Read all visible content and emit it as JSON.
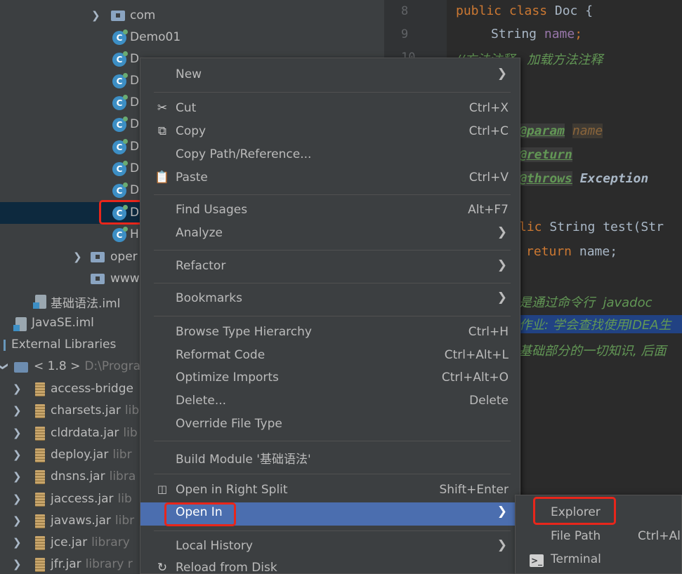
{
  "tree": {
    "com": "com",
    "demo01": "Demo01",
    "partial_items": [
      "D",
      "D",
      "D",
      "D",
      "D",
      "D",
      "D",
      "D"
    ],
    "selected_item": "D",
    "h_item": "H",
    "oper": "oper",
    "www": "www",
    "module_file": "基础语法.iml",
    "javase_file": "JavaSE.iml",
    "external_libraries": "External Libraries",
    "jdk_label": "< 1.8 >",
    "jdk_path": "D:\\Progra",
    "jars": [
      {
        "name": "access-bridge",
        "hint": ""
      },
      {
        "name": "charsets.jar",
        "hint": "lib"
      },
      {
        "name": "cldrdata.jar",
        "hint": "lib"
      },
      {
        "name": "deploy.jar",
        "hint": "libr"
      },
      {
        "name": "dnsns.jar",
        "hint": "libra"
      },
      {
        "name": "jaccess.jar",
        "hint": "lib"
      },
      {
        "name": "javaws.jar",
        "hint": "libr"
      },
      {
        "name": "jce.jar",
        "hint": "library"
      },
      {
        "name": "jfr.jar",
        "hint": "library r"
      }
    ]
  },
  "editor": {
    "line_numbers": [
      "8",
      "9",
      "10"
    ],
    "l8_kw": "public class",
    "l8_rest": " Doc {",
    "l9_type": "String",
    "l9_name": " name",
    "l9_semi": ";",
    "l10_comment": "//方法注释   加载方法注释",
    "tag_param": "@param",
    "param_name": "name",
    "tag_return": "@return",
    "tag_throws": "@throws",
    "exception": "Exception",
    "method_kw": "lic",
    "method_rest": " String test(Str",
    "return_kw": "return",
    "return_rest": " name;",
    "comment_a": "是通过命令行  javadoc",
    "comment_b": "作业: 学会查找使用IDEA生",
    "comment_c": "基础部分的一切知识, 后面"
  },
  "menu": {
    "new": "New",
    "cut": "Cut",
    "cut_sc": "Ctrl+X",
    "copy": "Copy",
    "copy_sc": "Ctrl+C",
    "copy_path": "Copy Path/Reference...",
    "paste": "Paste",
    "paste_sc": "Ctrl+V",
    "find_usages": "Find Usages",
    "find_usages_sc": "Alt+F7",
    "analyze": "Analyze",
    "refactor": "Refactor",
    "bookmarks": "Bookmarks",
    "browse_type_hierarchy": "Browse Type Hierarchy",
    "browse_sc": "Ctrl+H",
    "reformat_code": "Reformat Code",
    "reformat_sc": "Ctrl+Alt+L",
    "optimize_imports": "Optimize Imports",
    "optimize_sc": "Ctrl+Alt+O",
    "delete": "Delete...",
    "delete_sc": "Delete",
    "override_file_type": "Override File Type",
    "build_module": "Build Module '基础语法'",
    "open_right_split": "Open in Right Split",
    "open_right_split_sc": "Shift+Enter",
    "open_in": "Open In",
    "local_history": "Local History",
    "reload_from_disk": "Reload from Disk"
  },
  "submenu": {
    "explorer": "Explorer",
    "file_path": "File Path",
    "file_path_sc": "Ctrl+Al",
    "terminal": "Terminal"
  },
  "colors": {
    "menu_bg": "#3c3f41",
    "highlight": "#4b6eaf",
    "annotation_red": "#e8261b"
  }
}
